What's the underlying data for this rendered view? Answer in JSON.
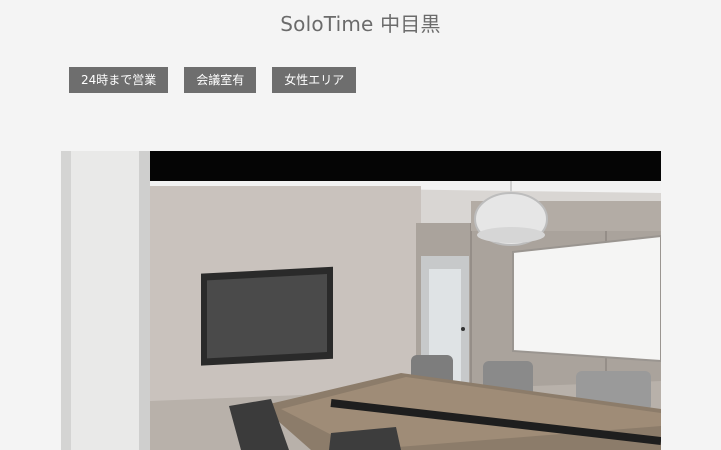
{
  "page": {
    "title": "SoloTime 中目黒"
  },
  "tags": [
    {
      "label": "24時まで営業"
    },
    {
      "label": "会議室有"
    },
    {
      "label": "女性エリア"
    }
  ],
  "photo": {
    "subject": "meeting-room"
  },
  "colors": {
    "background": "#f4f4f4",
    "tag_background": "#6e6e6e",
    "tag_text": "#ffffff",
    "title_text": "#6b6b6b"
  }
}
